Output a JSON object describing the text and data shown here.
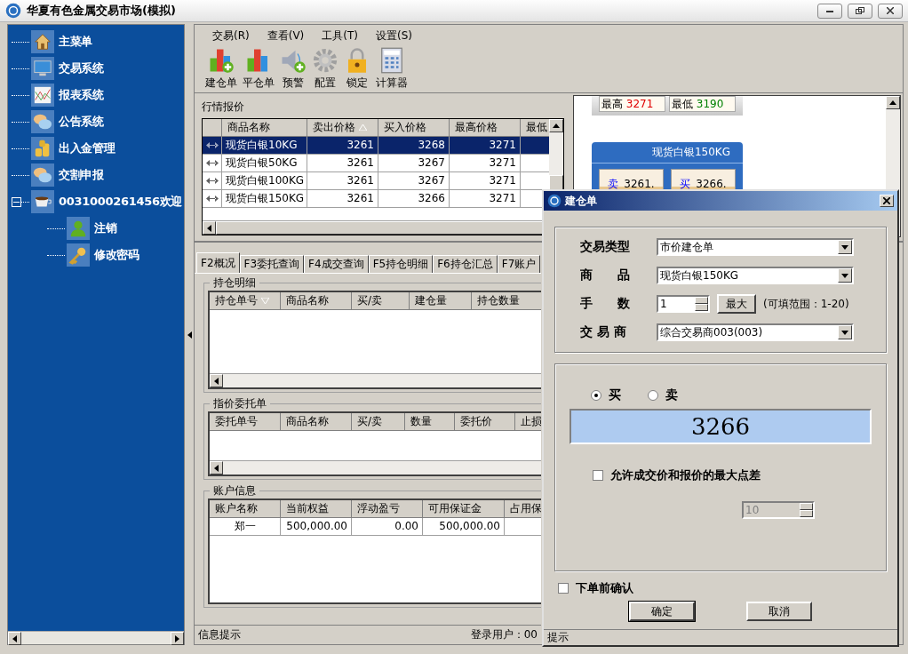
{
  "window": {
    "title": "华夏有色金属交易市场(模拟)"
  },
  "sidebar": {
    "items": [
      {
        "label": "主菜单"
      },
      {
        "label": "交易系统"
      },
      {
        "label": "报表系统"
      },
      {
        "label": "公告系统"
      },
      {
        "label": "出入金管理"
      },
      {
        "label": "交割申报"
      },
      {
        "label": "0031000261456欢迎",
        "expanded": true,
        "children": [
          {
            "label": "注销"
          },
          {
            "label": "修改密码"
          }
        ]
      }
    ]
  },
  "menu": [
    "交易(R)",
    "查看(V)",
    "工具(T)",
    "设置(S)"
  ],
  "toolbar": [
    "建仓单",
    "平仓单",
    "预警",
    "配置",
    "锁定",
    "计算器"
  ],
  "quotes": {
    "title": "行情报价",
    "columns": [
      "商品名称",
      "卖出价格",
      "买入价格",
      "最高价格",
      "最低"
    ],
    "rows": [
      {
        "selected": true,
        "cells": [
          "现货白银10KG",
          "3261",
          "3268",
          "3271"
        ]
      },
      {
        "selected": false,
        "cells": [
          "现货白银50KG",
          "3261",
          "3267",
          "3271"
        ]
      },
      {
        "selected": false,
        "cells": [
          "现货白银100KG",
          "3261",
          "3267",
          "3271"
        ]
      },
      {
        "selected": false,
        "cells": [
          "现货白银150KG",
          "3261",
          "3266",
          "3271"
        ]
      }
    ]
  },
  "quote_board": {
    "stats": [
      {
        "label": "最高",
        "value": "3271",
        "color": "#e00000"
      },
      {
        "label": "最低",
        "value": "3190",
        "color": "#008000"
      }
    ],
    "card": {
      "title": "现货白银150KG",
      "sell_label": "卖",
      "sell_price": "3261.",
      "buy_label": "买",
      "buy_price": "3266."
    }
  },
  "tabs": [
    {
      "label": "F2概况",
      "selected": true
    },
    {
      "label": "F3委托查询",
      "selected": false
    },
    {
      "label": "F4成交查询",
      "selected": false
    },
    {
      "label": "F5持仓明细",
      "selected": false
    },
    {
      "label": "F6持仓汇总",
      "selected": false
    },
    {
      "label": "F7账户",
      "selected": false
    }
  ],
  "positions": {
    "title": "持仓明细",
    "columns": [
      "持仓单号",
      "商品名称",
      "买/卖",
      "建仓量",
      "持仓数量"
    ]
  },
  "orders": {
    "title": "指价委托单",
    "columns": [
      "委托单号",
      "商品名称",
      "买/卖",
      "数量",
      "委托价",
      "止损"
    ]
  },
  "account": {
    "title": "账户信息",
    "columns": [
      "账户名称",
      "当前权益",
      "浮动盈亏",
      "可用保证金",
      "占用保"
    ],
    "rows": [
      [
        "郑一",
        "500,000.00",
        "0.00",
        "500,000.00"
      ]
    ]
  },
  "status_bar": {
    "message": "信息提示",
    "user": "登录用户：00"
  },
  "dialog": {
    "title": "建仓单",
    "trade_type": {
      "label": "交易类型",
      "value": "市价建仓单"
    },
    "product": {
      "label": "商　　品",
      "value": "现货白银150KG"
    },
    "lots": {
      "label": "手　　数",
      "value": "1",
      "max_button": "最大",
      "hint": "(可填范围：1-20)"
    },
    "dealer": {
      "label": "交 易 商",
      "value": "综合交易商003(003)"
    },
    "sides": [
      {
        "label": "买",
        "selected": true
      },
      {
        "label": "卖",
        "selected": false
      }
    ],
    "price": "3266",
    "allow_spread": {
      "label": "允许成交价和报价的最大点差",
      "checked": false
    },
    "spread": {
      "value": "10",
      "disabled": true
    },
    "confirm": {
      "label": "下单前确认",
      "checked": false
    },
    "buttons": [
      "确定",
      "取消"
    ],
    "status": "提示"
  }
}
